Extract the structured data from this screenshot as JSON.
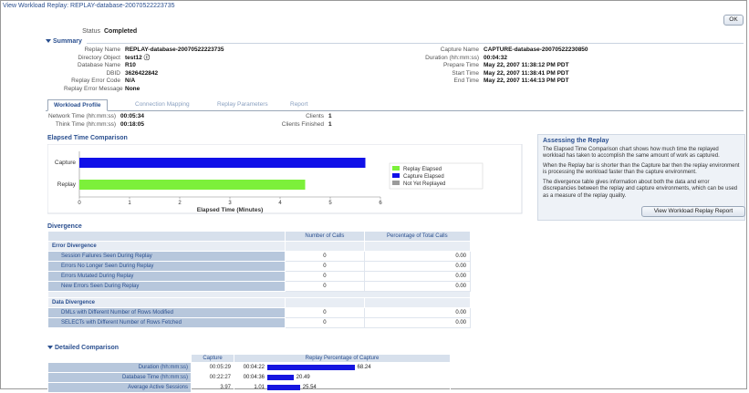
{
  "header": {
    "breadcrumb": "View Workload Replay: REPLAY-database-20070522223735",
    "ok_label": "OK"
  },
  "status": {
    "label": "Status",
    "value": "Completed"
  },
  "summary": {
    "title": "Summary",
    "left": [
      {
        "k": "Replay Name",
        "v": "REPLAY-database-20070522223735"
      },
      {
        "k": "Directory Object",
        "v": "test12 ⓘ"
      },
      {
        "k": "Database Name",
        "v": "R10"
      },
      {
        "k": "DBID",
        "v": "3626422842"
      },
      {
        "k": "Replay Error Code",
        "v": "N/A"
      },
      {
        "k": "Replay Error Message",
        "v": "None"
      }
    ],
    "right": [
      {
        "k": "Capture Name",
        "v": "CAPTURE-database-20070522230850"
      },
      {
        "k": "Duration (hh:mm:ss)",
        "v": "00:04:32"
      },
      {
        "k": "Prepare Time",
        "v": "May 22, 2007 11:38:12 PM PDT"
      },
      {
        "k": "Start Time",
        "v": "May 22, 2007 11:38:41 PM PDT"
      },
      {
        "k": "End Time",
        "v": "May 22, 2007 11:44:13 PM PDT"
      }
    ]
  },
  "tabs": [
    {
      "label": "Workload Profile",
      "active": true
    },
    {
      "label": "Connection Mapping",
      "active": false
    },
    {
      "label": "Replay Parameters",
      "active": false
    },
    {
      "label": "Report",
      "active": false
    }
  ],
  "profile": {
    "network_label": "Network Time (hh:mm:ss)",
    "network_value": "00:05:34",
    "think_label": "Think Time (hh:mm:ss)",
    "think_value": "00:18:05",
    "clients_label": "Clients",
    "clients_value": "1",
    "finished_label": "Clients Finished",
    "finished_value": "1"
  },
  "elapsed": {
    "title": "Elapsed Time Comparison"
  },
  "chart_data": {
    "type": "bar",
    "orientation": "horizontal",
    "categories": [
      "Capture",
      "Replay"
    ],
    "series": [
      {
        "name": "Replay Elapsed",
        "category": "Replay",
        "value": 4.5,
        "color": "#7cf03a"
      },
      {
        "name": "Capture Elapsed",
        "category": "Capture",
        "value": 5.7,
        "color": "#1010e8"
      },
      {
        "name": "Not Yet Replayed",
        "category": "Replay",
        "value": 0,
        "color": "#9b9b9b"
      }
    ],
    "xlabel": "Elapsed Time (Minutes)",
    "xticks": [
      "0",
      "1",
      "2",
      "3",
      "4",
      "5",
      "6"
    ],
    "xlim": [
      0,
      6
    ],
    "legend_position": "right"
  },
  "help": {
    "title": "Assessing the Replay",
    "p1": "The Elapsed Time Comparison chart shows how much time the replayed workload has taken to accomplish the same amount of work as captured.",
    "p2": "When the Replay bar is shorter than the Capture bar then the replay environment is processing the workload faster than the capture environment.",
    "p3": "The divergence table gives information about both the data and error discrepancies between the replay and capture environments, which can be used as a measure of the replay quality.",
    "button": "View Workload Replay Report"
  },
  "divergence": {
    "title": "Divergence",
    "col_calls": "Number of Calls",
    "col_pct": "Percentage of Total Calls",
    "groups": [
      {
        "name": "Error Divergence",
        "items": [
          {
            "name": "Session Failures Seen During Replay",
            "calls": "0",
            "pct": "0.00"
          },
          {
            "name": "Errors No Longer Seen During Replay",
            "calls": "0",
            "pct": "0.00"
          },
          {
            "name": "Errors Mutated During Replay",
            "calls": "0",
            "pct": "0.00"
          },
          {
            "name": "New Errors Seen During Replay",
            "calls": "0",
            "pct": "0.00"
          }
        ]
      },
      {
        "name": "Data Divergence",
        "items": [
          {
            "name": "DMLs with Different Number of Rows Modified",
            "calls": "0",
            "pct": "0.00"
          },
          {
            "name": "SELECTs with Different Number of Rows Fetched",
            "calls": "0",
            "pct": "0.00"
          }
        ]
      }
    ]
  },
  "detailed": {
    "title": "Detailed Comparison",
    "col_capture": "Capture",
    "col_replay": "Replay Percentage of Capture",
    "rows": [
      {
        "name": "Duration (hh:mm:ss)",
        "capture": "00:05:29",
        "replay": "00:04:22",
        "pct_label": "68.24",
        "pct": 68.24
      },
      {
        "name": "Database Time (hh:mm:ss)",
        "capture": "00:22:27",
        "replay": "00:04:36",
        "pct_label": "20.49",
        "pct": 20.49
      },
      {
        "name": "Average Active Sessions",
        "capture": "3.97",
        "replay": "1.01",
        "pct_label": "25.54",
        "pct": 25.54
      }
    ]
  }
}
